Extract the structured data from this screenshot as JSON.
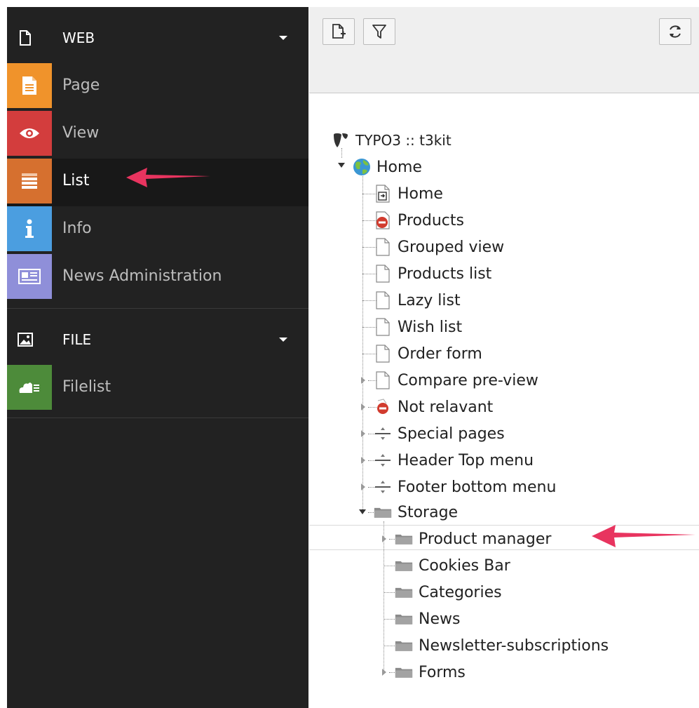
{
  "module_menu": {
    "groups": [
      {
        "label": "WEB",
        "icon": "page-icon",
        "modules": [
          {
            "label": "Page",
            "icon": "page-module-icon",
            "color": "#f0932b"
          },
          {
            "label": "View",
            "icon": "eye-icon",
            "color": "#d33d3d"
          },
          {
            "label": "List",
            "icon": "list-icon",
            "color": "#d6702f"
          },
          {
            "label": "Info",
            "icon": "info-icon",
            "color": "#4b9ee0"
          },
          {
            "label": "News Administration",
            "icon": "news-icon",
            "color": "#8f8fd9"
          }
        ]
      },
      {
        "label": "FILE",
        "icon": "image-icon",
        "modules": [
          {
            "label": "Filelist",
            "icon": "cloud-files-icon",
            "color": "#4d8b3a"
          }
        ]
      }
    ],
    "active_module": "List"
  },
  "toolbar": {
    "buttons": [
      "new-page-icon",
      "filter-icon",
      "refresh-icon"
    ]
  },
  "tree": {
    "root": {
      "label": "TYPO3 :: t3kit",
      "icon": "typo3-logo-icon"
    },
    "home": {
      "label": "Home",
      "icon": "globe-icon"
    },
    "children": [
      {
        "label": "Home",
        "icon": "shortcut-page-icon"
      },
      {
        "label": "Products",
        "icon": "page-hidden-icon"
      },
      {
        "label": "Grouped view",
        "icon": "page-icon"
      },
      {
        "label": "Products list",
        "icon": "page-icon"
      },
      {
        "label": "Lazy list",
        "icon": "page-icon"
      },
      {
        "label": "Wish list",
        "icon": "page-icon"
      },
      {
        "label": "Order form",
        "icon": "page-icon"
      },
      {
        "label": "Compare pre-view",
        "icon": "page-icon"
      },
      {
        "label": "Not relavant",
        "icon": "hidden-icon"
      },
      {
        "label": "Special pages",
        "icon": "spacer-icon"
      },
      {
        "label": "Header Top menu",
        "icon": "spacer-icon"
      },
      {
        "label": "Footer bottom menu",
        "icon": "spacer-icon"
      },
      {
        "label": "Storage",
        "icon": "folder-icon"
      }
    ],
    "storage_children": [
      {
        "label": "Product manager",
        "icon": "folder-icon"
      },
      {
        "label": "Cookies Bar",
        "icon": "folder-icon"
      },
      {
        "label": "Categories",
        "icon": "folder-icon"
      },
      {
        "label": "News",
        "icon": "folder-icon"
      },
      {
        "label": "Newsletter-subscriptions",
        "icon": "folder-icon"
      },
      {
        "label": "Forms",
        "icon": "folder-icon"
      }
    ],
    "selected": "Product manager"
  },
  "colors": {
    "menu_bg": "#222222",
    "menu_active_bg": "#181818",
    "toolbar_bg": "#efefef",
    "annotation_arrow": "#e8345f"
  }
}
